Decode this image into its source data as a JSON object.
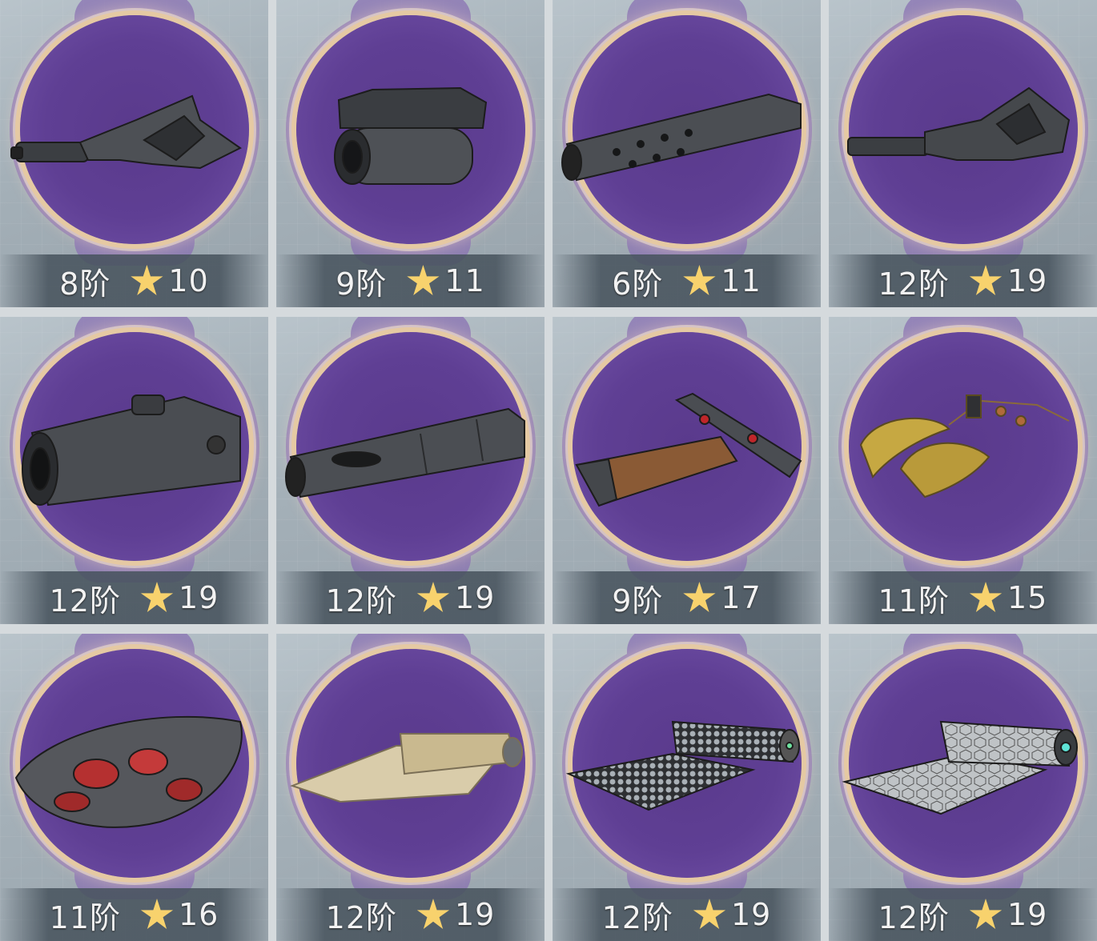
{
  "items": [
    {
      "name": "buttstock-tactical-a",
      "tier": "8阶",
      "stars": "10",
      "icon": "gun-stock-icon"
    },
    {
      "name": "scope-compact",
      "tier": "9阶",
      "stars": "11",
      "icon": "scope-icon"
    },
    {
      "name": "barrel-ported",
      "tier": "6阶",
      "stars": "11",
      "icon": "barrel-icon"
    },
    {
      "name": "buttstock-tactical-b",
      "tier": "12阶",
      "stars": "19",
      "icon": "gun-stock-icon"
    },
    {
      "name": "scope-large",
      "tier": "12阶",
      "stars": "19",
      "icon": "scope-icon"
    },
    {
      "name": "suppressor",
      "tier": "12阶",
      "stars": "19",
      "icon": "suppressor-icon"
    },
    {
      "name": "grip-foregrip",
      "tier": "9阶",
      "stars": "17",
      "icon": "grip-icon"
    },
    {
      "name": "tassel-charm",
      "tier": "11阶",
      "stars": "15",
      "icon": "tassel-icon"
    },
    {
      "name": "dragon-scale-plate",
      "tier": "11阶",
      "stars": "16",
      "icon": "armor-plate-icon"
    },
    {
      "name": "cloth-roll",
      "tier": "12阶",
      "stars": "19",
      "icon": "cloth-roll-icon"
    },
    {
      "name": "chainmail-roll",
      "tier": "12阶",
      "stars": "19",
      "icon": "chainmail-roll-icon"
    },
    {
      "name": "hex-fabric-roll",
      "tier": "12阶",
      "stars": "19",
      "icon": "hex-fabric-roll-icon"
    }
  ],
  "colors": {
    "ring_fill": "#5f3f94",
    "ring_edge": "#e5c9a3",
    "star": "#f8d26d",
    "tile_bg": "#a4b0b8"
  }
}
